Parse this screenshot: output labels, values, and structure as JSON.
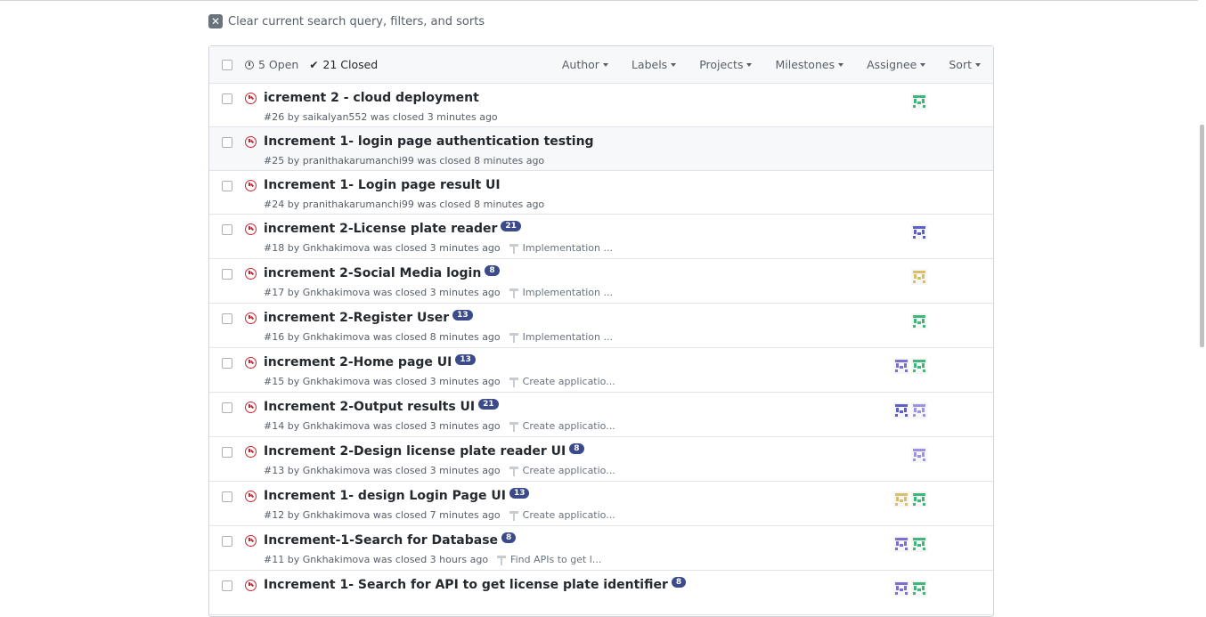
{
  "clear_search": {
    "label": "Clear current search query, filters, and sorts"
  },
  "header": {
    "open_label": "5 Open",
    "closed_label": "21 Closed",
    "filters": [
      "Author",
      "Labels",
      "Projects",
      "Milestones",
      "Assignee",
      "Sort"
    ]
  },
  "colors": {
    "closed_icon": "#cb2431",
    "badge": "#3a4a8a",
    "link_text": "#24292e",
    "meta_text": "#586069"
  },
  "issues": [
    {
      "title": "icrement 2 - cloud deployment",
      "badge": "",
      "meta": "#26 by saikalyan552 was closed 3 minutes ago",
      "milestone": "",
      "avatars": [
        "green"
      ]
    },
    {
      "title": "Increment 1- login page authentication testing",
      "badge": "",
      "meta": "#25 by pranithakarumanchi99 was closed 8 minutes ago",
      "milestone": "",
      "avatars": []
    },
    {
      "title": "Increment 1- Login page result UI",
      "badge": "",
      "meta": "#24 by pranithakarumanchi99 was closed 8 minutes ago",
      "milestone": "",
      "avatars": []
    },
    {
      "title": "increment 2-License plate reader",
      "badge": "21",
      "meta": "#18 by Gnkhakimova was closed 3 minutes ago",
      "milestone": "Implementation ...",
      "avatars": [
        "blue"
      ]
    },
    {
      "title": "increment 2-Social Media login",
      "badge": "8",
      "meta": "#17 by Gnkhakimova was closed 3 minutes ago",
      "milestone": "Implementation ...",
      "avatars": [
        "yellow"
      ]
    },
    {
      "title": "increment 2-Register User",
      "badge": "13",
      "meta": "#16 by Gnkhakimova was closed 8 minutes ago",
      "milestone": "Implementation ...",
      "avatars": [
        "green"
      ]
    },
    {
      "title": "increment 2-Home page UI",
      "badge": "13",
      "meta": "#15 by Gnkhakimova was closed 3 minutes ago",
      "milestone": "Create applicatio...",
      "avatars": [
        "purple",
        "green"
      ]
    },
    {
      "title": "Increment 2-Output results UI",
      "badge": "21",
      "meta": "#14 by Gnkhakimova was closed 3 minutes ago",
      "milestone": "Create applicatio...",
      "avatars": [
        "blue",
        "lavender"
      ]
    },
    {
      "title": "Increment 2-Design license plate reader UI",
      "badge": "8",
      "meta": "#13 by Gnkhakimova was closed 3 minutes ago",
      "milestone": "Create applicatio...",
      "avatars": [
        "lavender"
      ]
    },
    {
      "title": "Increment 1- design Login Page UI",
      "badge": "13",
      "meta": "#12 by Gnkhakimova was closed 7 minutes ago",
      "milestone": "Create applicatio...",
      "avatars": [
        "yellow",
        "green"
      ]
    },
    {
      "title": "Increment-1-Search for Database",
      "badge": "8",
      "meta": "#11 by Gnkhakimova was closed 3 hours ago",
      "milestone": "Find APIs to get l...",
      "avatars": [
        "purple",
        "green"
      ]
    },
    {
      "title": "Increment 1- Search for API to get license plate identifier",
      "badge": "8",
      "meta": "",
      "milestone": "",
      "avatars": [
        "purple",
        "green"
      ]
    }
  ]
}
